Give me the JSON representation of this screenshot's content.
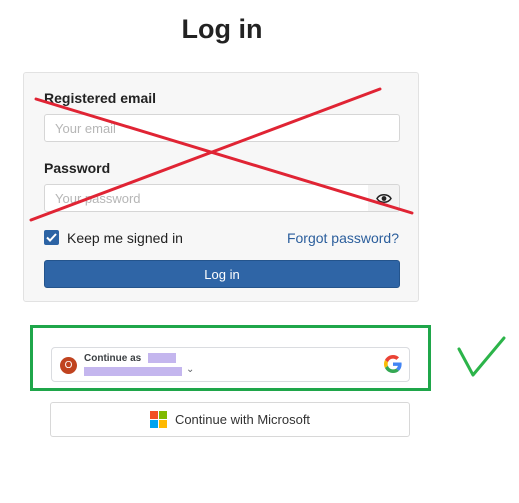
{
  "page": {
    "title": "Log in"
  },
  "form": {
    "email_label": "Registered email",
    "email_placeholder": "Your email",
    "password_label": "Password",
    "password_placeholder": "Your password",
    "keep_signed_in_label": "Keep me signed in",
    "keep_signed_in_checked": true,
    "forgot_password_label": "Forgot password?",
    "login_button_label": "Log in"
  },
  "google": {
    "continue_as_label": "Continue as",
    "avatar_initial": "O"
  },
  "microsoft": {
    "button_label": "Continue with Microsoft"
  },
  "icons": {
    "eye": "eye-icon",
    "checkbox": "checkmark-icon",
    "google": "google-logo",
    "microsoft": "microsoft-logo",
    "chevron": "chevron-down-icon"
  },
  "colors": {
    "primary_button": "#2f65a6",
    "link": "#2b5e9c",
    "annotation_cross": "#e02434",
    "annotation_box": "#1fa64a",
    "annotation_check": "#2cb44a"
  }
}
